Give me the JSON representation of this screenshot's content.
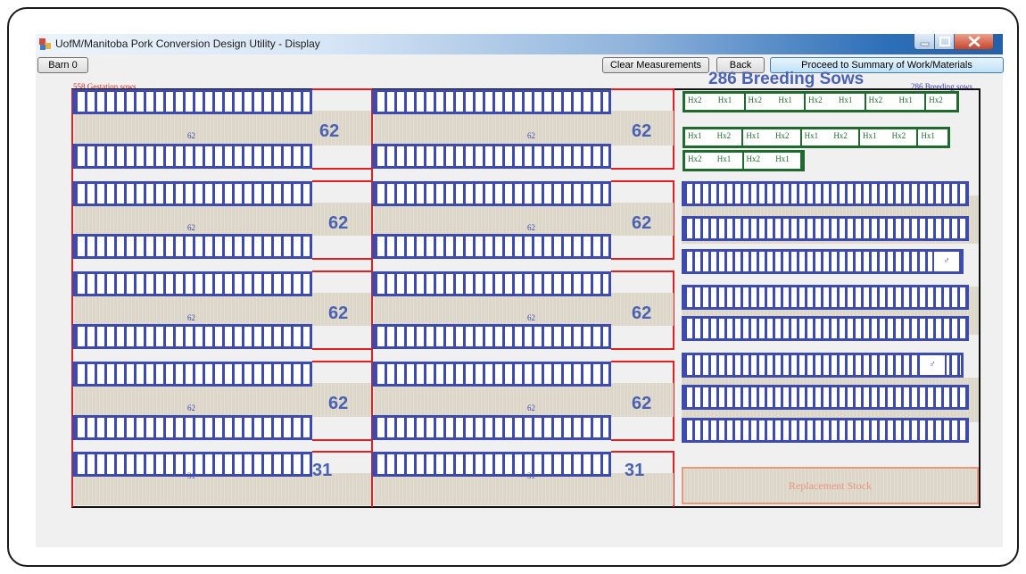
{
  "window": {
    "title": "UofM/Manitoba Pork Conversion Design Utility - Display",
    "icon": "app-icon",
    "controls": [
      "minimize-icon",
      "maximize-icon",
      "close-icon"
    ]
  },
  "toolbar": {
    "barn_label": "Barn 0",
    "clear_label": "Clear Measurements",
    "back_label": "Back",
    "proceed_label": "Proceed to Summary of Work/Materials"
  },
  "labels": {
    "gestation": "558 Gestation sows",
    "breeding_heading": "286 Breeding Sows",
    "breeding_small": "286 Breeding sows",
    "replacement": "Replacement Stock"
  },
  "gestation_rooms": {
    "counts": [
      "62",
      "62",
      "62",
      "62",
      "62",
      "62",
      "62",
      "62",
      "31",
      "31"
    ]
  },
  "breeding_pens": {
    "row1": [
      "Hx2",
      "Hx1",
      "Hx2",
      "Hx1",
      "Hx2",
      "Hx1",
      "Hx2",
      "Hx1",
      "Hx2"
    ],
    "row2": [
      "Hx1",
      "Hx2",
      "Hx1",
      "Hx2",
      "Hx1",
      "Hx2",
      "Hx1",
      "Hx2",
      "Hx1"
    ],
    "row3": [
      "Hx2",
      "Hx1",
      "Hx2",
      "Hx1"
    ]
  },
  "boar_pens": [
    "♂",
    "♂"
  ],
  "colors": {
    "gestation_border": "#e02020",
    "crate": "#3d4bb0",
    "pen": "#1f6b2e",
    "alley": "#dcd7c9",
    "replacement": "#e8967c",
    "title_blue": "#4a62b4"
  }
}
